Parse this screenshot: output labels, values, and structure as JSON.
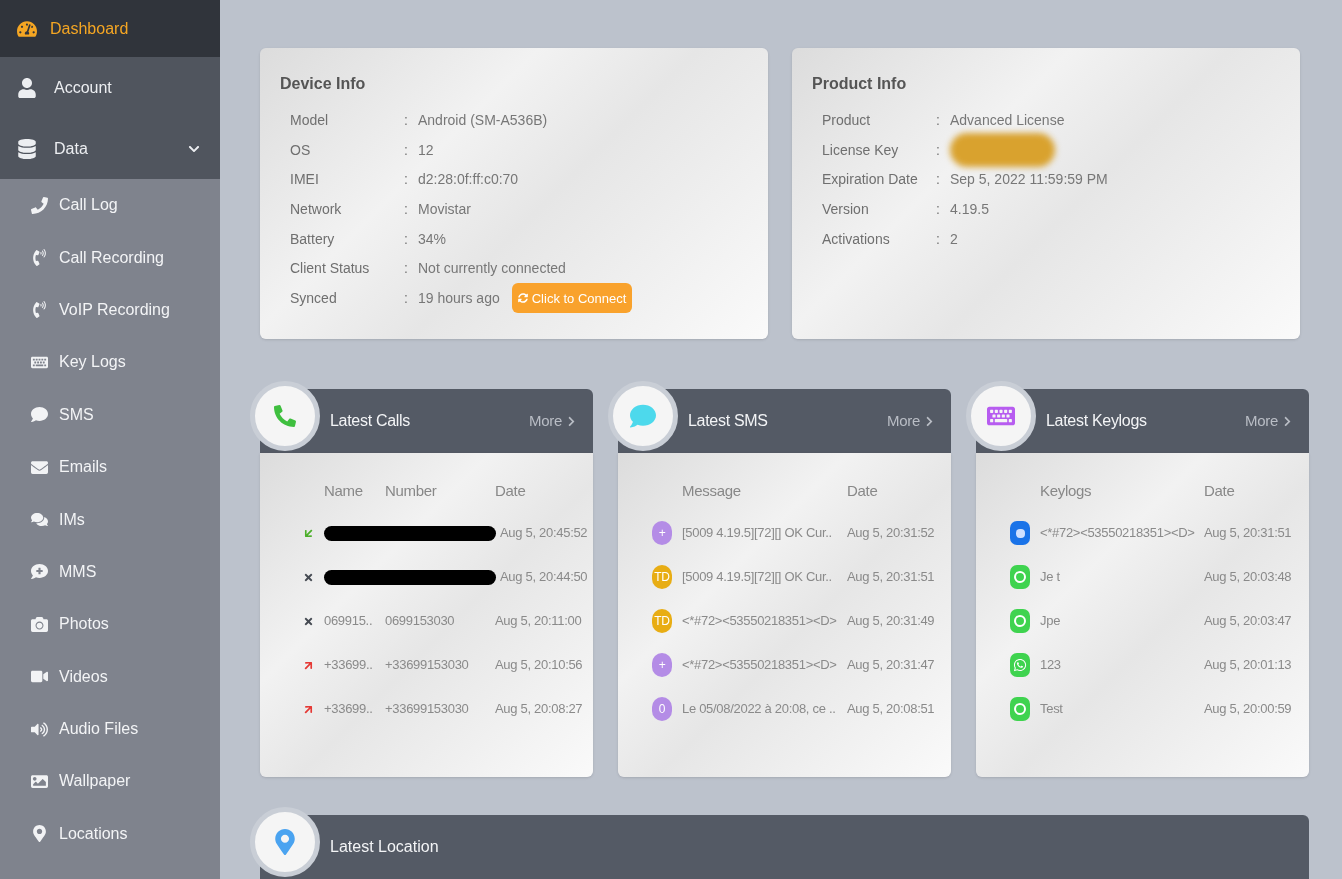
{
  "sidebar": {
    "items": [
      {
        "label": "Dashboard",
        "selected": true
      },
      {
        "label": "Account",
        "selected": false
      },
      {
        "label": "Data",
        "selected": false,
        "expanded": true,
        "children": [
          {
            "label": "Call Log"
          },
          {
            "label": "Call Recording"
          },
          {
            "label": "VoIP Recording"
          },
          {
            "label": "Key Logs"
          },
          {
            "label": "SMS"
          },
          {
            "label": "Emails"
          },
          {
            "label": "IMs"
          },
          {
            "label": "MMS"
          },
          {
            "label": "Photos"
          },
          {
            "label": "Videos"
          },
          {
            "label": "Audio Files"
          },
          {
            "label": "Wallpaper"
          },
          {
            "label": "Locations"
          }
        ]
      }
    ]
  },
  "device_info": {
    "title": "Device Info",
    "rows": [
      {
        "label": "Model",
        "separator": ":",
        "value": "Android (SM-A536B)"
      },
      {
        "label": "OS",
        "separator": ":",
        "value": "12"
      },
      {
        "label": "IMEI",
        "separator": ":",
        "value": "d2:28:0f:ff:c0:70"
      },
      {
        "label": "Network",
        "separator": ":",
        "value": "Movistar"
      },
      {
        "label": "Battery",
        "separator": ":",
        "value": "34%"
      },
      {
        "label": "Client Status",
        "separator": ":",
        "value": "Not currently connected"
      },
      {
        "label": "Synced",
        "separator": ":",
        "value": "19 hours ago",
        "button": "Click to Connect"
      }
    ]
  },
  "product_info": {
    "title": "Product Info",
    "rows": [
      {
        "label": "Product",
        "separator": ":",
        "value": "Advanced License"
      },
      {
        "label": "License Key",
        "separator": ":",
        "redacted": true
      },
      {
        "label": "Expiration Date",
        "separator": ":",
        "value": "Sep 5, 2022 11:59:59 PM"
      },
      {
        "label": "Version",
        "separator": ":",
        "value": "4.19.5"
      },
      {
        "label": "Activations",
        "separator": ":",
        "value": "2"
      }
    ]
  },
  "latest_calls": {
    "title": "Latest Calls",
    "more": "More",
    "columns": [
      "Name",
      "Number",
      "Date"
    ],
    "rows": [
      {
        "kind": "incoming",
        "redacted": true,
        "date": "Aug 5, 20:45:52"
      },
      {
        "kind": "missed",
        "redacted": true,
        "date": "Aug 5, 20:44:50"
      },
      {
        "kind": "missed",
        "redacted": false,
        "name": "069915..",
        "number": "0699153030",
        "date": "Aug 5, 20:11:00"
      },
      {
        "kind": "outgoing",
        "redacted": false,
        "name": "+33699..",
        "number": "+33699153030",
        "date": "Aug 5, 20:10:56"
      },
      {
        "kind": "outgoing",
        "redacted": false,
        "name": "+33699..",
        "number": "+33699153030",
        "date": "Aug 5, 20:08:27"
      }
    ]
  },
  "latest_sms": {
    "title": "Latest SMS",
    "more": "More",
    "columns": [
      "Message",
      "Date"
    ],
    "rows": [
      {
        "avatar": "+",
        "color": "#b48ce6",
        "message": "[5009 4.19.5][72][] OK Cur..",
        "date": "Aug 5, 20:31:52"
      },
      {
        "avatar": "TD",
        "color": "#e8ad14",
        "message": "[5009 4.19.5][72][] OK Cur..",
        "date": "Aug 5, 20:31:51"
      },
      {
        "avatar": "TD",
        "color": "#e8ad14",
        "message": "<*#72><53550218351><D>",
        "date": "Aug 5, 20:31:49"
      },
      {
        "avatar": "+",
        "color": "#b48ce6",
        "message": "<*#72><53550218351><D>",
        "date": "Aug 5, 20:31:47"
      },
      {
        "avatar": "0",
        "color": "#b48ce6",
        "message": "Le 05/08/2022 à 20:08, ce ..",
        "date": "Aug 5, 20:08:51"
      }
    ]
  },
  "latest_keylogs": {
    "title": "Latest Keylogs",
    "more": "More",
    "columns": [
      "Keylogs",
      "Date"
    ],
    "rows": [
      {
        "kind": "messages",
        "text": "<*#72><53550218351><D>",
        "date": "Aug 5, 20:31:51"
      },
      {
        "kind": "whatsapp-business",
        "text": "Je t",
        "date": "Aug 5, 20:03:48"
      },
      {
        "kind": "whatsapp-business",
        "text": "Jpe",
        "date": "Aug 5, 20:03:47"
      },
      {
        "kind": "whatsapp",
        "text": "123",
        "date": "Aug 5, 20:01:13"
      },
      {
        "kind": "whatsapp-business",
        "text": "Test",
        "date": "Aug 5, 20:00:59"
      }
    ]
  },
  "latest_location": {
    "title": "Latest Location"
  }
}
